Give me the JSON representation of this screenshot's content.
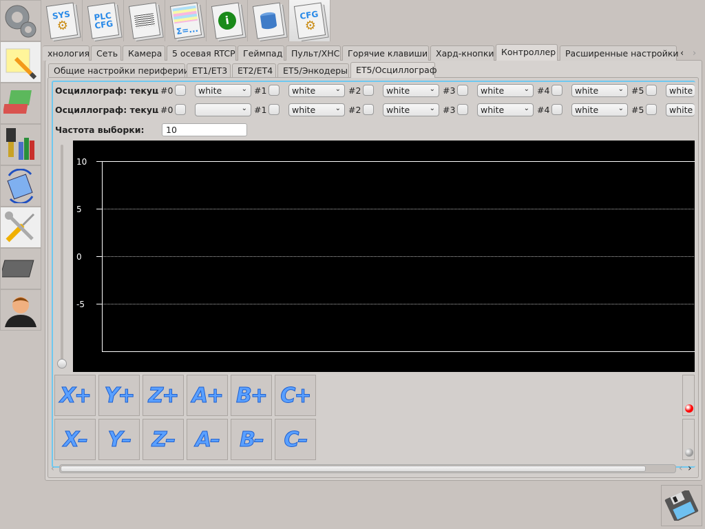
{
  "top_toolbar": [
    {
      "name": "sys-config",
      "label": "SYS"
    },
    {
      "name": "plc-config",
      "label": "PLC CFG"
    },
    {
      "name": "text-document",
      "label": ""
    },
    {
      "name": "formula-table",
      "label": "Σ=..."
    },
    {
      "name": "info",
      "label": "i"
    },
    {
      "name": "database",
      "label": ""
    },
    {
      "name": "cfg",
      "label": "CFG"
    }
  ],
  "main_tabs": [
    "хнология",
    "Сеть",
    "Камера",
    "5 осевая RTCP",
    "Геймпад",
    "Пульт/XHC",
    "Горячие клавиши",
    "Хард-кнопки",
    "Контроллер",
    "Расширенные настройки"
  ],
  "main_tab_selected": "Контроллер",
  "sub_tabs": [
    "Общие настройки периферии",
    "ET1/ET3",
    "ET2/ET4",
    "ET5/Энкодеры",
    "ET5/Осциллограф"
  ],
  "sub_tab_selected": "ET5/Осциллограф",
  "rows": [
    {
      "label": "Осциллограф: текущее",
      "channels": [
        {
          "id": "#0",
          "color": "white"
        },
        {
          "id": "#1",
          "color": "white"
        },
        {
          "id": "#2",
          "color": "white"
        },
        {
          "id": "#3",
          "color": "white"
        },
        {
          "id": "#4",
          "color": "white"
        },
        {
          "id": "#5",
          "color": "white"
        }
      ]
    },
    {
      "label": "Осциллограф: текущая",
      "channels": [
        {
          "id": "#0",
          "color": ""
        },
        {
          "id": "#1",
          "color": "white"
        },
        {
          "id": "#2",
          "color": "white"
        },
        {
          "id": "#3",
          "color": "white"
        },
        {
          "id": "#4",
          "color": "white"
        },
        {
          "id": "#5",
          "color": "white"
        }
      ]
    }
  ],
  "sample_rate": {
    "label": "Частота выборки:",
    "value": "10"
  },
  "scope": {
    "y_ticks": [
      "10",
      "5",
      "0",
      "-5"
    ],
    "ylim": [
      -10,
      10
    ],
    "background": "#000000",
    "grid": "dotted"
  },
  "jog": {
    "plus": [
      "X+",
      "Y+",
      "Z+",
      "A+",
      "B+",
      "C+"
    ],
    "minus": [
      "X–",
      "Y–",
      "Z–",
      "A–",
      "B–",
      "C–"
    ]
  },
  "indicators": [
    {
      "color": "#ff0000"
    },
    {
      "color": "#999999"
    }
  ],
  "colors": {
    "accent": "#6ec8f0",
    "jog_text": "#5aa0ff"
  }
}
